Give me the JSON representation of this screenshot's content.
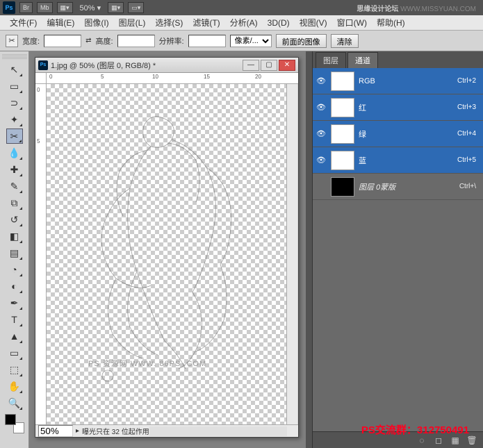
{
  "topbar": {
    "btn_br": "Br",
    "btn_mb": "Mb",
    "zoom": "50%",
    "watermark_bold": "思缘设计论坛",
    "watermark_url": "WWW.MISSYUAN.COM"
  },
  "menu": {
    "file": "文件(F)",
    "edit": "编辑(E)",
    "image": "图像(I)",
    "layer": "图层(L)",
    "select": "选择(S)",
    "filter": "滤镜(T)",
    "analysis": "分析(A)",
    "3d": "3D(D)",
    "view": "视图(V)",
    "window": "窗口(W)",
    "help": "帮助(H)"
  },
  "options": {
    "width_label": "宽度:",
    "height_label": "高度:",
    "resolution_label": "分辨率:",
    "unit": "像素/...",
    "front_image_btn": "前面的图像",
    "clear_btn": "清除",
    "swap": "⇄"
  },
  "document": {
    "title": "1.jpg @ 50% (图层 0, RGB/8) *",
    "status_zoom": "50%",
    "status_text": "曝光只在 32 位起作用",
    "canvas_watermark": "PS 资源网   WWW. 86PS .COM",
    "ruler_marks": [
      "0",
      "5",
      "10",
      "15",
      "20"
    ]
  },
  "panels": {
    "tab_layers": "图层",
    "tab_channels": "通道",
    "channels": [
      {
        "name": "RGB",
        "shortcut": "Ctrl+2",
        "selected": true,
        "eye": true,
        "dark": false
      },
      {
        "name": "红",
        "shortcut": "Ctrl+3",
        "selected": true,
        "eye": true,
        "dark": false
      },
      {
        "name": "绿",
        "shortcut": "Ctrl+4",
        "selected": true,
        "eye": true,
        "dark": false
      },
      {
        "name": "蓝",
        "shortcut": "Ctrl+5",
        "selected": true,
        "eye": true,
        "dark": false
      },
      {
        "name": "图层 0蒙版",
        "shortcut": "Ctrl+\\",
        "selected": false,
        "eye": false,
        "dark": true
      }
    ]
  },
  "overlay": {
    "qq_group": "PS交流群：312750491"
  }
}
